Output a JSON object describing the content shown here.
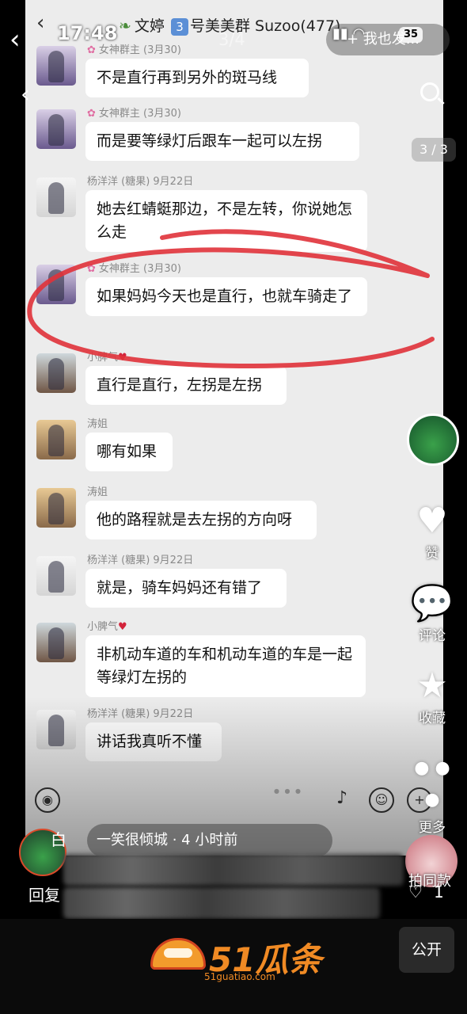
{
  "status_bar": {
    "time": "17:48",
    "page_indicator": "3/4",
    "battery": "35"
  },
  "follow_button": {
    "label": "+ 我也发..."
  },
  "image_counter": "3 / 3",
  "chat": {
    "header_prefix": "文婷",
    "header_number": "3",
    "header_suffix": "号美美群 Suzoo(477)",
    "messages": [
      {
        "sender": "女神群主 (3月30)",
        "text": "不是直行再到另外的斑马线"
      },
      {
        "sender": "女神群主 (3月30)",
        "text": "而是要等绿灯后跟车一起可以左拐"
      },
      {
        "sender": "杨洋洋 (糖果) 9月22日",
        "text": "她去红蜻蜓那边，不是左转，你说她怎么走"
      },
      {
        "sender": "女神群主 (3月30)",
        "text": "如果妈妈今天也是直行，也就车骑走了"
      },
      {
        "sender": "小脾气",
        "text": "直行是直行，左拐是左拐"
      },
      {
        "sender": "涛姐",
        "text": "哪有如果"
      },
      {
        "sender": "涛姐",
        "text": "他的路程就是去左拐的方向呀"
      },
      {
        "sender": "杨洋洋 (糖果) 9月22日",
        "text": "就是，骑车妈妈还有错了"
      },
      {
        "sender": "小脾气",
        "text": "非机动车道的车和机动车道的车是一起等绿灯左拐的"
      },
      {
        "sender": "杨洋洋 (糖果) 9月22日",
        "text": "讲话我真听不懂"
      }
    ]
  },
  "side_rail": {
    "like_label": "赞",
    "comment_label": "评论",
    "favorite_label": "收藏",
    "more_label": "更多",
    "same_style_label": "拍同款",
    "like_count": "1"
  },
  "comment": {
    "placeholder": "一笑很倾城 · 4 小时前",
    "reply_label": "回复",
    "partial_char": "白"
  },
  "footer": {
    "logo_text": "51瓜条",
    "logo_url": "51guatiao.com",
    "public_button": "公开"
  },
  "colors": {
    "annotation": "#e0323a",
    "accent": "#fe2c55",
    "logo": "#f08a24",
    "bubble": "#ffffff",
    "chat_bg": "#ececec"
  }
}
